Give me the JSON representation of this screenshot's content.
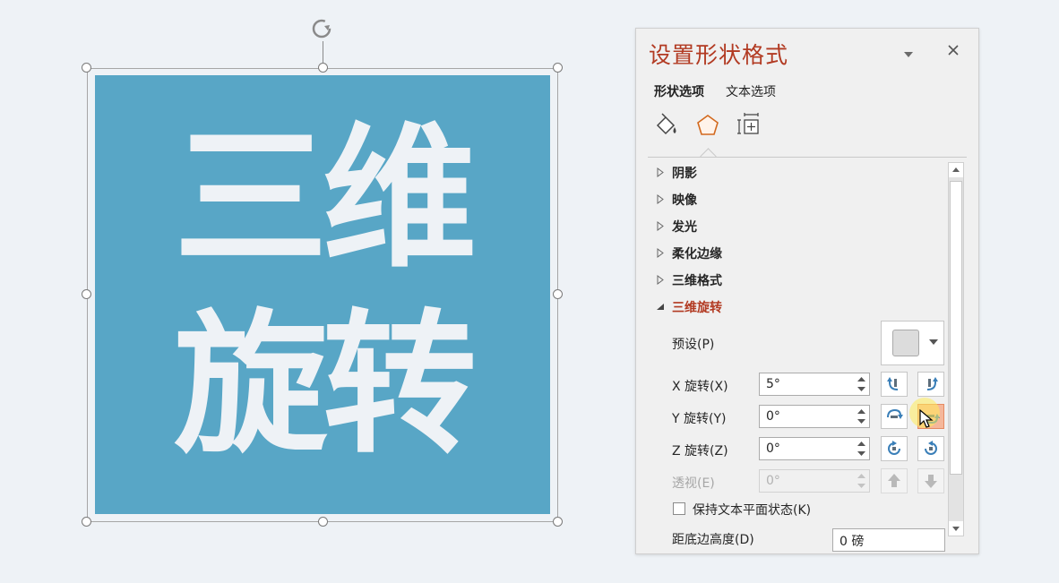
{
  "slide": {
    "shape_line1": "三维",
    "shape_line2": "旋转",
    "shape_fill": "#58a6c6",
    "text_color": "#eef2f6"
  },
  "pane": {
    "title": "设置形状格式",
    "tabs": [
      {
        "label": "形状选项",
        "active": true
      },
      {
        "label": "文本选项",
        "active": false
      }
    ],
    "icons": [
      "fill-line-icon",
      "effects-pentagon-icon",
      "size-properties-icon"
    ],
    "sections": [
      {
        "label": "阴影",
        "expanded": false
      },
      {
        "label": "映像",
        "expanded": false
      },
      {
        "label": "发光",
        "expanded": false
      },
      {
        "label": "柔化边缘",
        "expanded": false
      },
      {
        "label": "三维格式",
        "expanded": false
      },
      {
        "label": "三维旋转",
        "expanded": true
      }
    ],
    "rotation": {
      "preset_label": "预设(P)",
      "x_label": "X 旋转(X)",
      "x_value": "5°",
      "y_label": "Y 旋转(Y)",
      "y_value": "0°",
      "z_label": "Z 旋转(Z)",
      "z_value": "0°",
      "perspective_label": "透视(E)",
      "perspective_value": "0°",
      "keep_text_flat_label": "保持文本平面状态(K)",
      "keep_text_flat_checked": false,
      "distance_label": "距底边高度(D)",
      "distance_value": "0 磅"
    },
    "accent_color": "#b23a22"
  }
}
